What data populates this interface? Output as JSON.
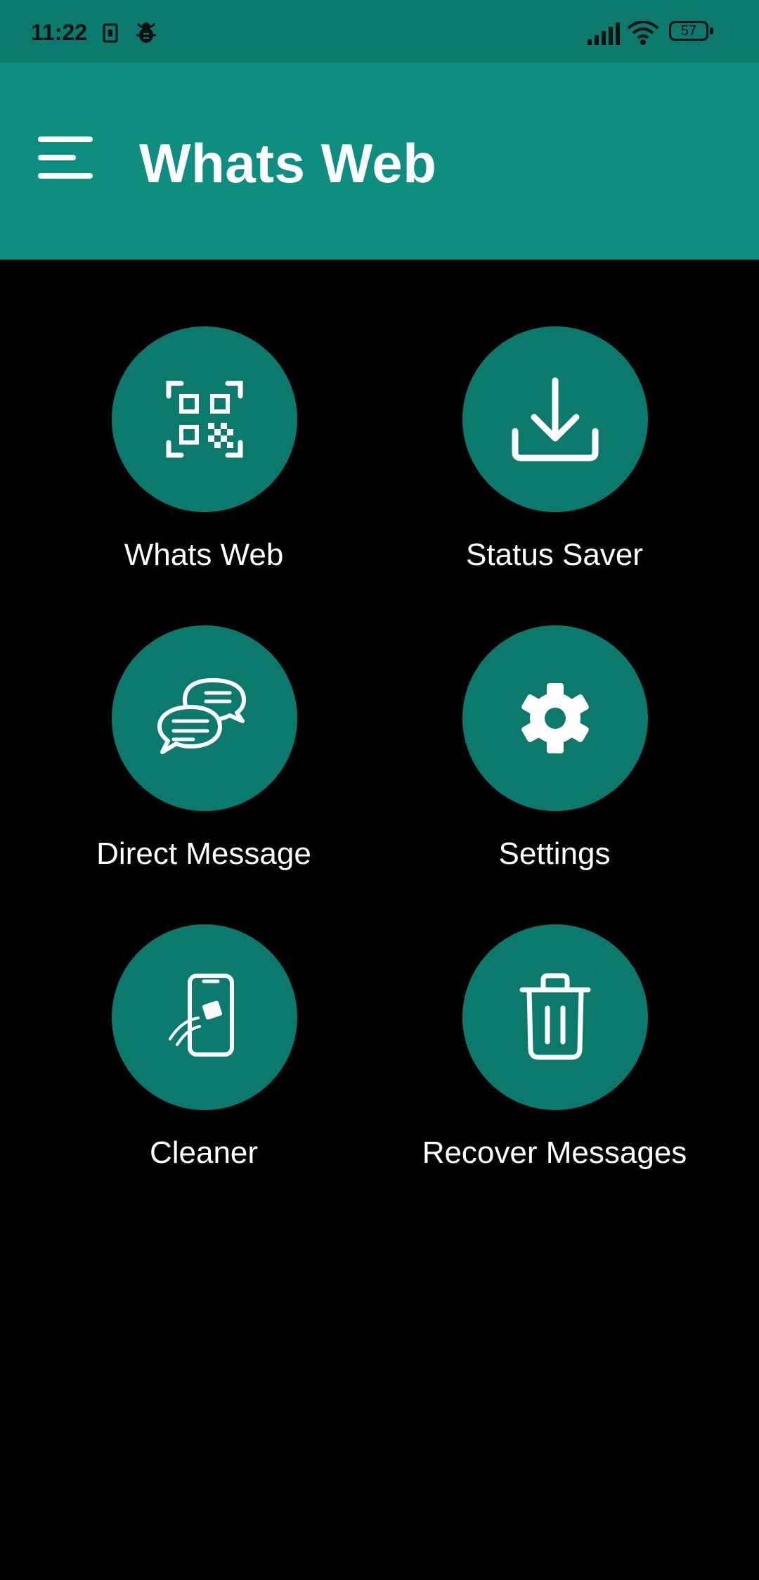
{
  "status_bar": {
    "time": "11:22",
    "battery": "57"
  },
  "app_bar": {
    "title": "Whats Web",
    "menu_icon": "menu-icon"
  },
  "tiles": [
    {
      "label": "Whats Web",
      "icon": "qr-code-icon"
    },
    {
      "label": "Status Saver",
      "icon": "download-icon"
    },
    {
      "label": "Direct Message",
      "icon": "chat-bubbles-icon"
    },
    {
      "label": "Settings",
      "icon": "gear-icon"
    },
    {
      "label": "Cleaner",
      "icon": "phone-clean-icon"
    },
    {
      "label": "Recover Messages",
      "icon": "trash-icon"
    }
  ],
  "colors": {
    "app_bar": "#0e8e80",
    "status_bar": "#0b7a6c",
    "tile_circle": "#0b7a6c",
    "background": "#000000"
  }
}
